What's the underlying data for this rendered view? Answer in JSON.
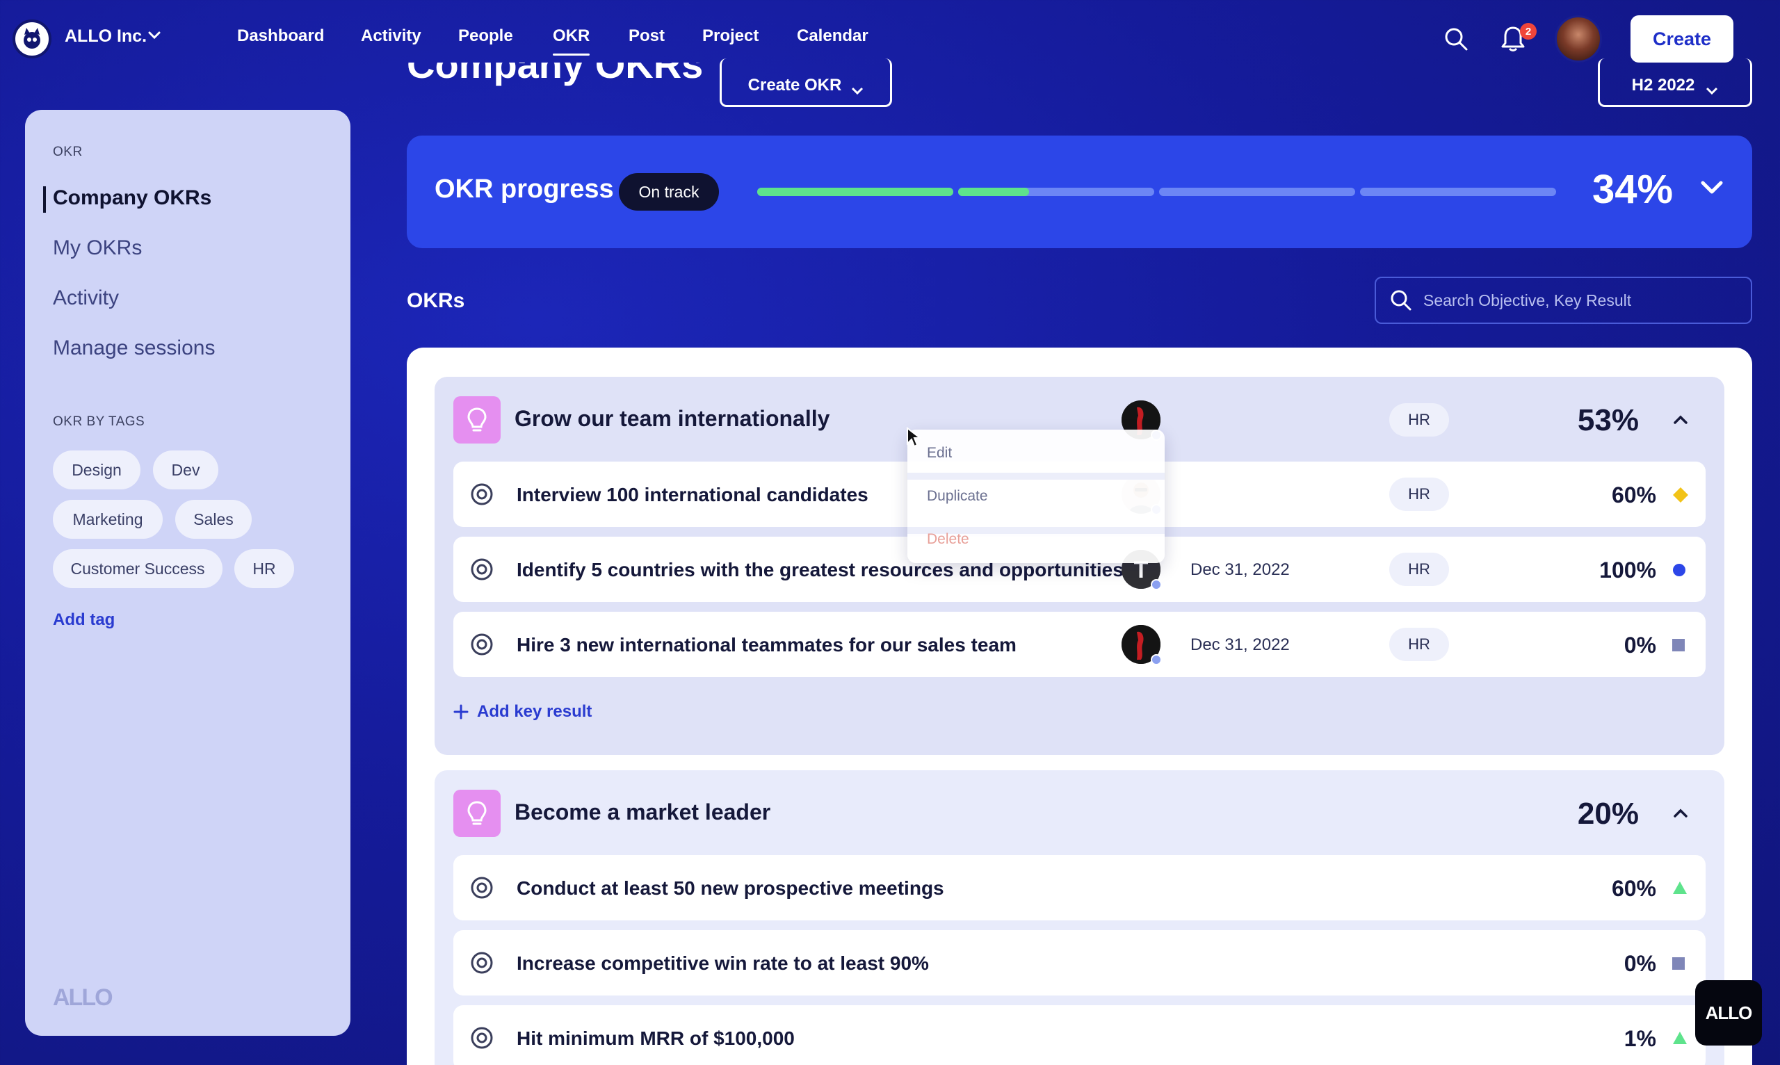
{
  "org": {
    "name": "ALLO Inc."
  },
  "nav": {
    "links": [
      "Dashboard",
      "Activity",
      "People",
      "OKR",
      "Post",
      "Project",
      "Calendar"
    ],
    "active": "OKR",
    "notifications_count": "2",
    "create_label": "Create"
  },
  "sidebar": {
    "section_label": "OKR",
    "items": [
      "Company OKRs",
      "My OKRs",
      "Activity",
      "Manage sessions"
    ],
    "tags_label": "OKR BY TAGS",
    "tags": [
      "Design",
      "Dev",
      "Marketing",
      "Sales",
      "Customer Success",
      "HR"
    ],
    "add_tag_label": "Add tag",
    "logo_text": "ALLO"
  },
  "header": {
    "title": "Company OKRs",
    "create_okr_label": "Create OKR",
    "period_label": "H2 2022"
  },
  "progress": {
    "label": "OKR progress",
    "status": "On track",
    "percent_text": "34%",
    "percent": 34,
    "segment_fills": [
      1.0,
      0.36,
      0.0,
      0.0
    ]
  },
  "okrs": {
    "heading": "OKRs",
    "search_placeholder": "Search Objective, Key Result"
  },
  "objectives": [
    {
      "title": "Grow our team internationally",
      "percent": "53%",
      "tag": "HR",
      "key_results": [
        {
          "title": "Interview 100 international candidates",
          "date": "",
          "tag": "HR",
          "percent": "60%",
          "status": "diamond",
          "status_color": "#f2c318"
        },
        {
          "title": "Identify 5 countries with the greatest resources and opportunities",
          "date": "Dec 31, 2022",
          "tag": "HR",
          "percent": "100%",
          "status": "circle",
          "status_color": "#2c46e8"
        },
        {
          "title": "Hire 3 new international teammates for our sales team",
          "date": "Dec 31, 2022",
          "tag": "HR",
          "percent": "0%",
          "status": "square",
          "status_color": "#7f86b8"
        }
      ],
      "add_key_result_label": "Add key result"
    },
    {
      "title": "Become a market leader",
      "percent": "20%",
      "key_results": [
        {
          "title": "Conduct at least 50 new prospective meetings",
          "percent": "60%",
          "status": "triangle",
          "status_color": "#5ee38c"
        },
        {
          "title": "Increase competitive win rate to at least 90%",
          "percent": "0%",
          "status": "square",
          "status_color": "#7f86b8"
        },
        {
          "title": "Hit minimum MRR of $100,000",
          "percent": "1%",
          "status": "triangle",
          "status_color": "#5ee38c"
        }
      ]
    }
  ],
  "context_menu": {
    "items": [
      "Edit",
      "Duplicate",
      "Delete"
    ]
  },
  "badge": {
    "text": "ALLO"
  },
  "colors": {
    "accent": "#2c46e8",
    "background": "#151b9a",
    "on_track": "#5ee38c"
  }
}
